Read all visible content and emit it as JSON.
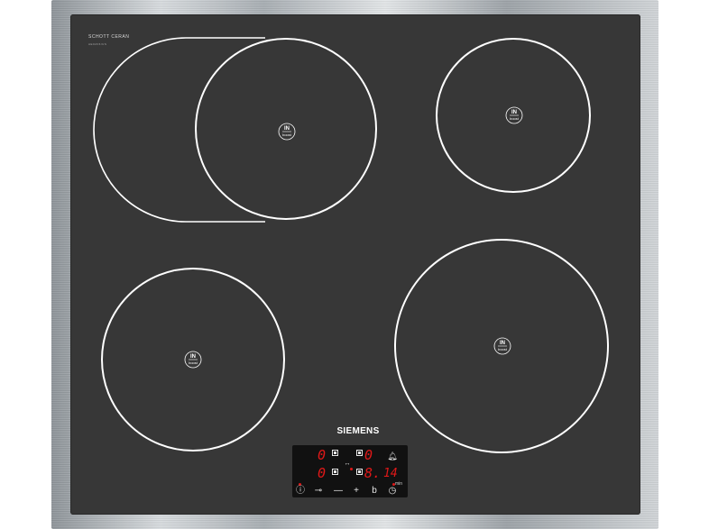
{
  "appliance": {
    "brand": "SIEMENS",
    "glass_maker": "SCHOTT CERAN",
    "glass_maker_fineprint": "AE02F6/US",
    "zone_label_top": "IN",
    "zone_label_bottom": "boost"
  },
  "display": {
    "left_zone_top_level": "0",
    "right_zone_top_level": "0",
    "left_zone_bottom_level": "0",
    "right_zone_bottom_level": "8.",
    "timer_value": "14",
    "timer_unit": "min"
  },
  "controls": {
    "power_symbol": "ⓘ",
    "lock_symbol": "⊸",
    "minus_symbol": "—",
    "plus_symbol": "+",
    "bridge_symbol": "b",
    "timer_symbol": "◷"
  },
  "colors": {
    "glass": "#373737",
    "zone_line": "#ffffff",
    "led": "#e01818"
  }
}
